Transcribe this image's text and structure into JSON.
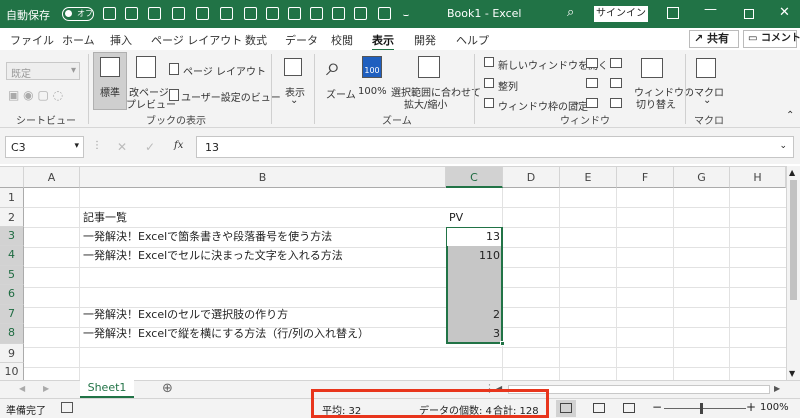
{
  "titlebar": {
    "autosave": "自動保存",
    "toggle": "オフ",
    "doc_title": "Book1 - Excel",
    "signin": "サインイン"
  },
  "tabs": [
    "ファイル",
    "ホーム",
    "挿入",
    "ページ レイアウト",
    "数式",
    "データ",
    "校閲",
    "表示",
    "開発",
    "ヘルプ"
  ],
  "active_tab": "表示",
  "share": "共有",
  "comment": "コメント",
  "ribbon": {
    "sheetview": {
      "dropdown": "既定",
      "group": "シートビュー"
    },
    "bookview": {
      "normal": "標準",
      "pagebreak1": "改ページ",
      "pagebreak2": "プレビュー",
      "page_layout": "ページ レイアウト",
      "custom": "ユーザー設定のビュー",
      "group": "ブックの表示"
    },
    "show": {
      "label": "表示",
      "group": ""
    },
    "zoom": {
      "zoom": "ズーム",
      "hundred": "100%",
      "fit1": "選択範囲に合わせて",
      "fit2": "拡大/縮小",
      "group": "ズーム"
    },
    "window": {
      "new": "新しいウィンドウを開く",
      "arrange": "整列",
      "freeze": "ウィンドウ枠の固定",
      "switch1": "ウィンドウの",
      "switch2": "切り替え",
      "group": "ウィンドウ"
    },
    "macro": {
      "label": "マクロ",
      "group": "マクロ"
    }
  },
  "formula": {
    "cell_ref": "C3",
    "value": "13"
  },
  "columns": [
    "A",
    "B",
    "C",
    "D",
    "E",
    "F",
    "G",
    "H"
  ],
  "rows": [
    "1",
    "2",
    "3",
    "4",
    "5",
    "6",
    "7",
    "8",
    "9",
    "10"
  ],
  "cells": {
    "B2": "記事一覧",
    "C2": "PV",
    "B3": "一発解決！Excelで箇条書きや段落番号を使う方法",
    "C3": "13",
    "B4": "一発解決！Excelでセルに決まった文字を入れる方法",
    "C4": "110",
    "B7": "一発解決！Excelのセルで選択肢の作り方",
    "C7": "2",
    "B8": "一発解決！Excelで縦を横にする方法（行/列の入れ替え）",
    "C8": "3"
  },
  "sheet": "Sheet1",
  "status": {
    "ready": "準備完了",
    "average": "平均: 32",
    "count": "データの個数: 4",
    "sum": "合計: 128",
    "zoom": "100%"
  },
  "colors": {
    "brand": "#217346",
    "highlight": "#e8351c"
  }
}
